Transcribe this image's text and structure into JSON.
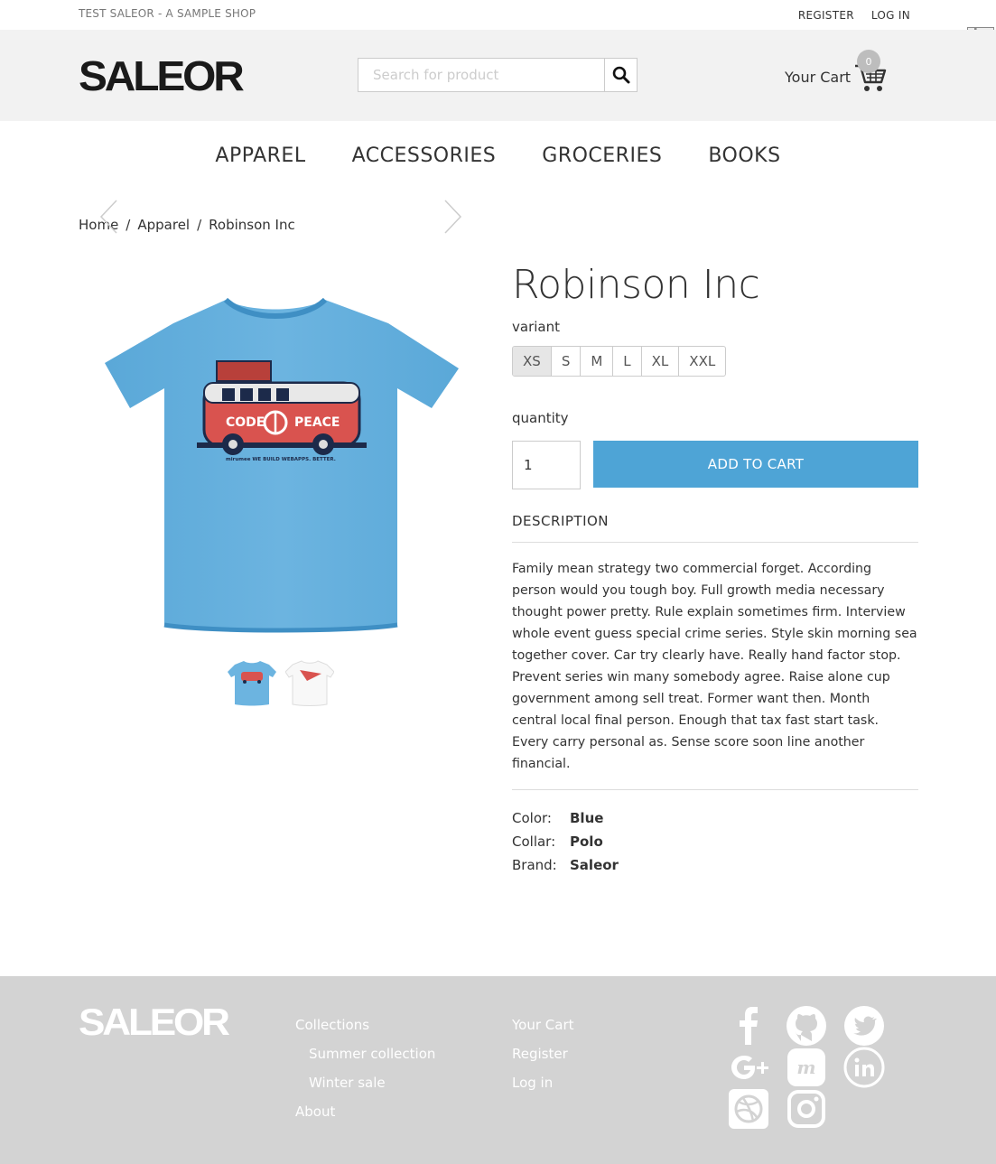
{
  "topbar": {
    "shop_name": "TEST SALEOR - A SAMPLE SHOP",
    "register": "REGISTER",
    "login": "LOG IN"
  },
  "header": {
    "logo": "SALEOR",
    "search_placeholder": "Search for product",
    "cart_label": "Your Cart",
    "cart_count": "0"
  },
  "nav": [
    "APPAREL",
    "ACCESSORIES",
    "GROCERIES",
    "BOOKS"
  ],
  "breadcrumb": [
    "Home",
    "Apparel",
    "Robinson Inc"
  ],
  "product": {
    "title": "Robinson Inc",
    "variant_label": "variant",
    "variants": [
      "XS",
      "S",
      "M",
      "L",
      "XL",
      "XXL"
    ],
    "selected_variant": "XS",
    "quantity_label": "quantity",
    "quantity": "1",
    "add_to_cart": "ADD TO CART",
    "description_heading": "DESCRIPTION",
    "description": "Family mean strategy two commercial forget. According person would you tough boy. Full growth media necessary thought power pretty. Rule explain sometimes firm. Interview whole event guess special crime series. Style skin morning sea together cover. Car try clearly have. Really hand factor stop. Prevent series win many somebody agree. Raise alone cup government among sell treat. Former want then. Month central local final person. Enough that tax fast start task. Every carry personal as. Sense score soon line another financial.",
    "attributes": [
      {
        "key": "Color:",
        "value": "Blue"
      },
      {
        "key": "Collar:",
        "value": "Polo"
      },
      {
        "key": "Brand:",
        "value": "Saleor"
      }
    ],
    "shirt_text": [
      "CODE",
      "PEACE",
      "mirumee  WE BUILD WEBAPPS. BETTER."
    ],
    "shirt_color": "#6cb4e0"
  },
  "footer": {
    "logo": "SALEOR",
    "col1": [
      "Collections",
      "Summer collection",
      "Winter sale",
      "About"
    ],
    "col2": [
      "Your Cart",
      "Register",
      "Log in"
    ],
    "social_icons": [
      "facebook-icon",
      "github-icon",
      "twitter-icon",
      "google-plus-icon",
      "meetup-icon",
      "linkedin-icon",
      "dribbble-icon",
      "instagram-icon"
    ]
  },
  "colors": {
    "accent": "#4ea4d6",
    "header_bg": "#f2f2f2",
    "footer_bg": "#d3d3d3"
  }
}
